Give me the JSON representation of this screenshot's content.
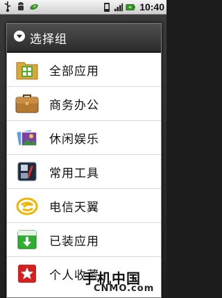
{
  "status_bar": {
    "time": "10:40",
    "left_icons": [
      "usb-icon",
      "android-bug-icon",
      "leaf-icon"
    ],
    "right_icons": [
      "phone-status-icon",
      "signal-icon",
      "battery-icon"
    ]
  },
  "dialog": {
    "title": "选择组",
    "items": [
      {
        "label": "全部应用",
        "icon": "all-apps-icon"
      },
      {
        "label": "商务办公",
        "icon": "briefcase-icon"
      },
      {
        "label": "休闲娱乐",
        "icon": "photos-icon"
      },
      {
        "label": "常用工具",
        "icon": "tools-icon"
      },
      {
        "label": "电信天翼",
        "icon": "telecom-icon"
      },
      {
        "label": "已装应用",
        "icon": "installed-download-icon"
      },
      {
        "label": "个人收藏",
        "icon": "favorite-star-icon"
      }
    ]
  },
  "watermark": {
    "cn": "手机中国",
    "en": "CNMO.com"
  },
  "colors": {
    "title_bar": "#3a3a3a",
    "divider": "#d9d9d9",
    "status_bar": "#e6e6e6"
  }
}
